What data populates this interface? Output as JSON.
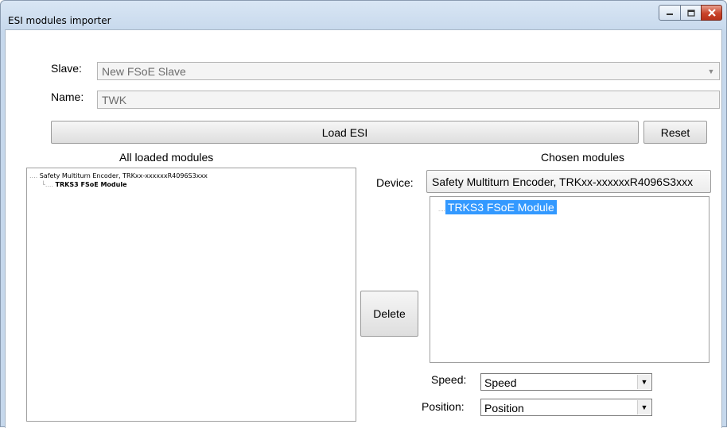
{
  "window": {
    "title": "ESI modules importer",
    "controls": {
      "minimize": "minimize-icon",
      "maximize": "maximize-icon",
      "close": "close-icon"
    }
  },
  "slave": {
    "label": "Slave:",
    "value": "New FSoE Slave"
  },
  "name": {
    "label": "Name:",
    "value": "TWK"
  },
  "buttons": {
    "load_esi": "Load ESI",
    "reset": "Reset",
    "delete": "Delete"
  },
  "all_modules": {
    "header": "All loaded modules",
    "tree": [
      {
        "connector": "....",
        "label": "Safety Multiturn Encoder, TRKxx-xxxxxxR4096S3xxx"
      },
      {
        "connector": "└....",
        "label": "TRKS3 FSoE Module"
      }
    ]
  },
  "chosen_modules": {
    "header": "Chosen modules",
    "device_label": "Device:",
    "device_value": "Safety Multiturn Encoder, TRKxx-xxxxxxR4096S3xxx",
    "tree": [
      {
        "connector": "....",
        "label": "TRKS3 FSoE Module",
        "selected": true
      }
    ]
  },
  "speed": {
    "label": "Speed:",
    "value": "Speed"
  },
  "position": {
    "label": "Position:",
    "value": "Position"
  },
  "colors": {
    "selection": "#3399ff",
    "close_button": "#c9432a"
  }
}
